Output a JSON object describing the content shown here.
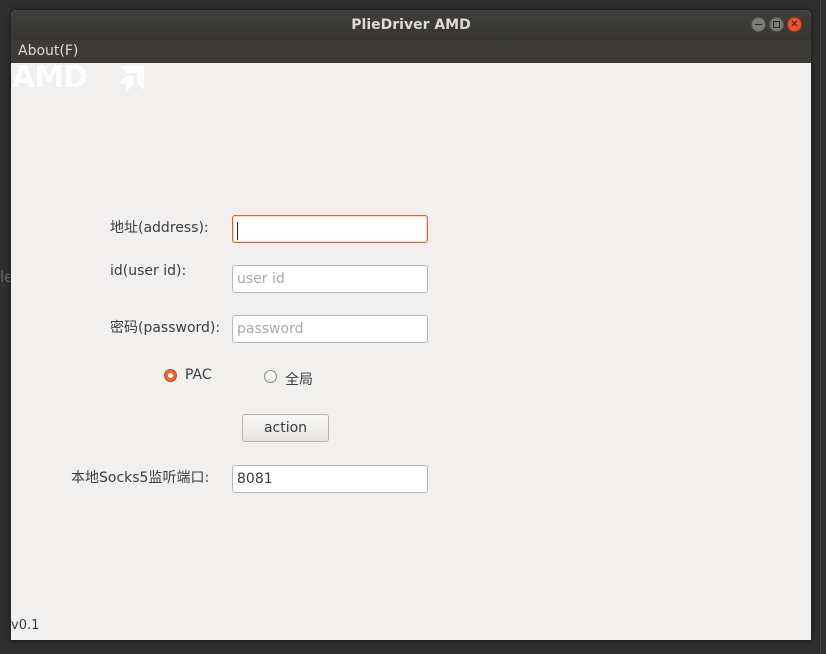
{
  "window": {
    "title": "PlieDriver AMD"
  },
  "menu": {
    "about_label": "About(F)"
  },
  "logo": {
    "text": "AMD"
  },
  "background": {
    "partial_text": "le"
  },
  "form": {
    "address_label": "地址(address):",
    "address_value": "",
    "userid_label": "id(user id):",
    "userid_placeholder": "user id",
    "password_label": "密码(password):",
    "password_placeholder": "password",
    "mode_options": [
      {
        "label": "PAC",
        "checked": true
      },
      {
        "label": "全局",
        "checked": false
      }
    ],
    "action_label": "action",
    "socks_port_label": "本地Socks5监听端口:",
    "socks_port_value": "8081"
  },
  "footer": {
    "version": "v0.1"
  },
  "colors": {
    "accent": "#e86a35",
    "focus_border": "#e4622b",
    "titlebar": "#3c3b37",
    "window_bg": "#f1f0ef"
  },
  "icons": {
    "minimize": "minimize-icon",
    "maximize": "maximize-icon",
    "close": "close-icon"
  }
}
